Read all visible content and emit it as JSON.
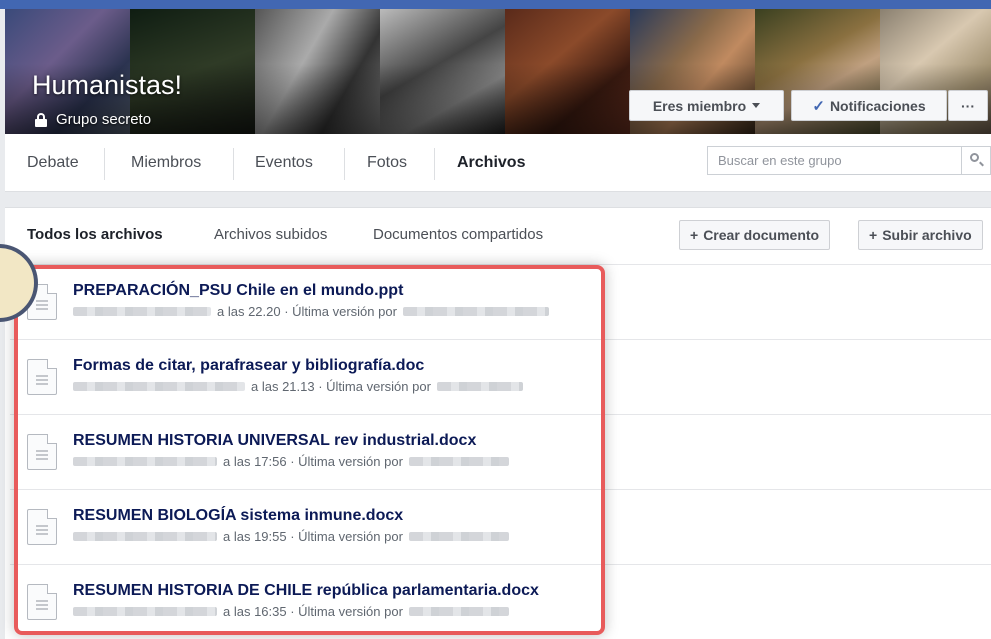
{
  "group": {
    "name": "Humanistas!",
    "privacy": "Grupo secreto",
    "member_button": "Eres miembro",
    "notifications_button": "Notificaciones",
    "more_button": "···"
  },
  "nav": {
    "tabs": [
      "Debate",
      "Miembros",
      "Eventos",
      "Fotos",
      "Archivos"
    ],
    "active_tab": "Archivos",
    "search_placeholder": "Buscar en este grupo"
  },
  "files": {
    "filter_tabs": [
      "Todos los archivos",
      "Archivos subidos",
      "Documentos compartidos"
    ],
    "create_button": "Crear documento",
    "upload_button": "Subir archivo",
    "items": [
      {
        "name": "PREPARACIÓN_PSU Chile en el mundo.ppt",
        "time": "a las 22.20 · Última versión por"
      },
      {
        "name": "Formas de citar, parafrasear y bibliografía.doc",
        "time": "a las 21.13 · Última versión por"
      },
      {
        "name": "RESUMEN HISTORIA UNIVERSAL rev industrial.docx",
        "time": "a las 17:56 · Última versión por"
      },
      {
        "name": "RESUMEN BIOLOGÍA sistema inmune.docx",
        "time": "a las 19:55 · Última versión por"
      },
      {
        "name": "RESUMEN HISTORIA DE CHILE república parlamentaria.docx",
        "time": "a las 16:35 · Última versión por"
      }
    ]
  },
  "colors": {
    "brand": "#4267b2",
    "highlight": "#e85b5b",
    "file_title": "#0c1a56"
  }
}
